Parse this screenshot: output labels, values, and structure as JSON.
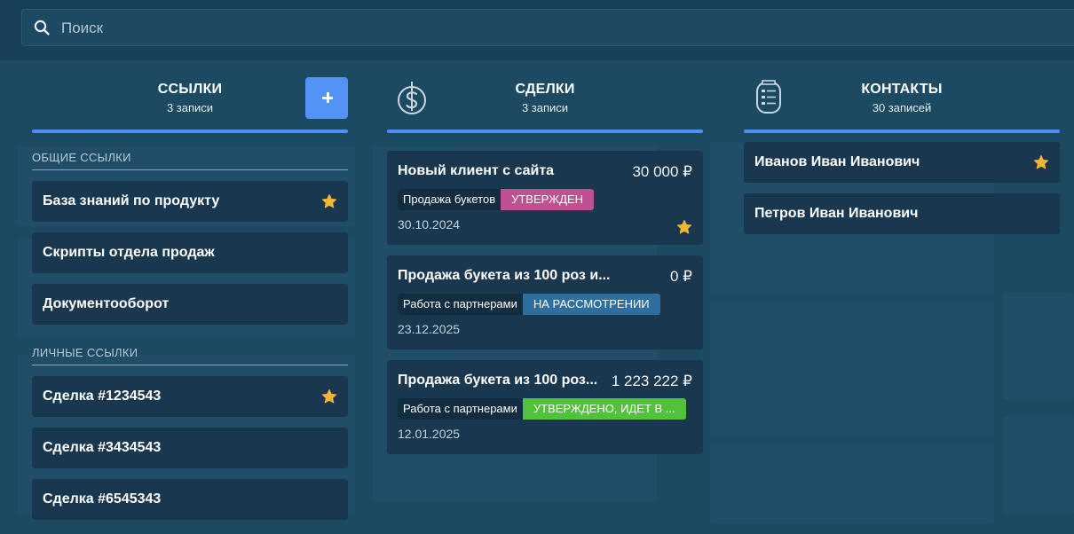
{
  "search": {
    "placeholder": "Поиск"
  },
  "colors": {
    "accent": "#4d8ff4",
    "add_button": "#5294f6",
    "star": "#f5b535",
    "status_approved": "#c0508f",
    "status_review": "#2f6f9f",
    "status_approved_in_progress": "#52c23d"
  },
  "links": {
    "title": "ССЫЛКИ",
    "count": "3 записи",
    "general_label": "ОБЩИЕ ССЫЛКИ",
    "general": [
      {
        "label": "База знаний по продукту",
        "starred": true
      },
      {
        "label": "Скрипты отдела продаж",
        "starred": false
      },
      {
        "label": "Документооборот",
        "starred": false
      }
    ],
    "personal_label": "ЛИЧНЫЕ ССЫЛКИ",
    "personal": [
      {
        "label": "Сделка #1234543",
        "starred": true
      },
      {
        "label": "Сделка #3434543",
        "starred": false
      },
      {
        "label": "Сделка #6545343",
        "starred": false
      }
    ]
  },
  "deals": {
    "title": "СДЕЛКИ",
    "count": "3 записи",
    "icon": "dollar-icon",
    "items": [
      {
        "title": "Новый клиент с сайта",
        "amount": "30 000 ₽",
        "funnel": "Продажа букетов",
        "status": "УТВЕРЖДЕН",
        "status_color": "#c0508f",
        "date": "30.10.2024",
        "starred": true
      },
      {
        "title": "Продажа букета из 100 роз и...",
        "amount": "0 ₽",
        "funnel": "Работа с партнерами",
        "status": "НА РАССМОТРЕНИИ",
        "status_color": "#2f6f9f",
        "date": "23.12.2025",
        "starred": false
      },
      {
        "title": "Продажа букета из 100 роз...",
        "amount": "1 223 222 ₽",
        "funnel": "Работа с партнерами",
        "status": "УТВЕРЖДЕНО, ИДЕТ В ...",
        "status_color": "#52c23d",
        "date": "12.01.2025",
        "starred": false
      }
    ]
  },
  "contacts": {
    "title": "КОНТАКТЫ",
    "count": "30 записей",
    "icon": "contact-list-icon",
    "items": [
      {
        "name": "Иванов Иван Иванович",
        "starred": true
      },
      {
        "name": "Петров Иван Иванович",
        "starred": false
      }
    ]
  }
}
